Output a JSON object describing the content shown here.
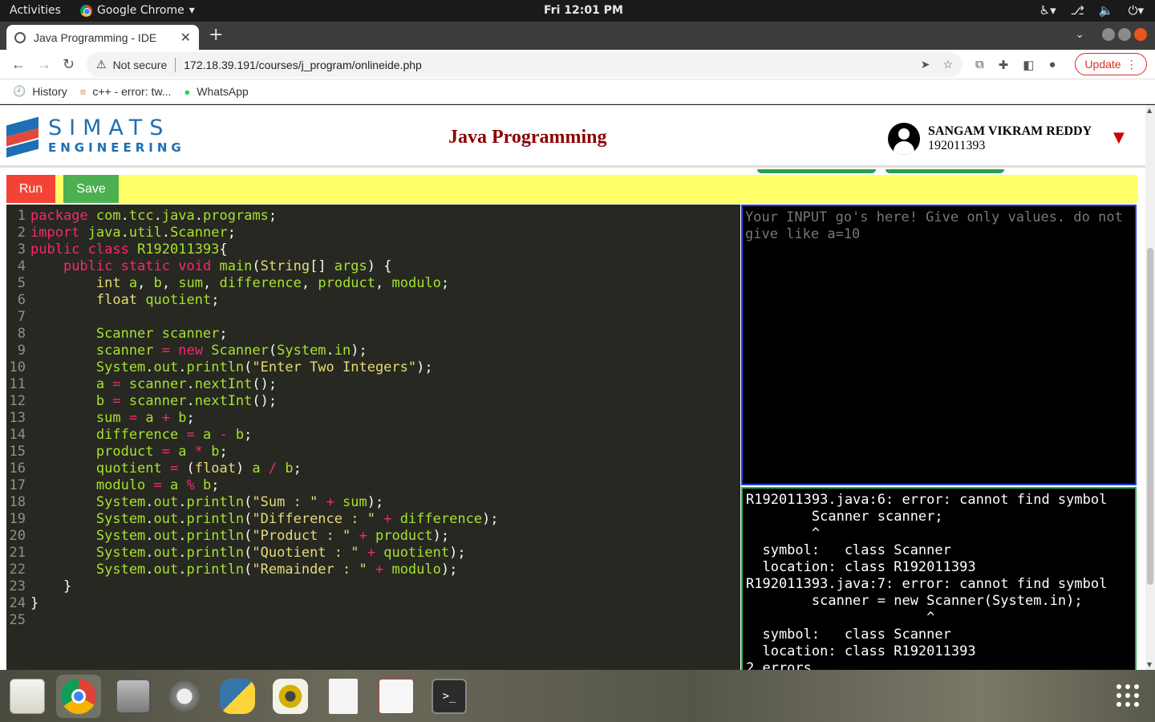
{
  "system": {
    "activities": "Activities",
    "app_name": "Google Chrome",
    "clock": "Fri 12:01 PM"
  },
  "browser": {
    "tab_title": "Java Programming - IDE",
    "security": "Not secure",
    "url": "172.18.39.191/courses/j_program/onlineide.php",
    "update_label": "Update",
    "bookmarks": [
      "History",
      "c++ - error: tw...",
      "WhatsApp"
    ]
  },
  "header": {
    "logo_top": "SIMATS",
    "logo_bottom": "ENGINEERING",
    "title": "Java Programming",
    "user_name": "SANGAM VIKRAM REDDY",
    "user_id": "192011393"
  },
  "controls": {
    "run_label": "Run",
    "save_label": "Save"
  },
  "editor": {
    "line_numbers": [
      "1",
      "2",
      "3",
      "4",
      "5",
      "6",
      "7",
      "8",
      "9",
      "10",
      "11",
      "12",
      "13",
      "14",
      "15",
      "16",
      "17",
      "18",
      "19",
      "20",
      "21",
      "22",
      "23",
      "24",
      "25"
    ]
  },
  "input": {
    "placeholder": "Your INPUT go's here! Give only values. do not give like a=10"
  },
  "output": {
    "text": "R192011393.java:6: error: cannot find symbol\n        Scanner scanner;\n        ^\n  symbol:   class Scanner\n  location: class R192011393\nR192011393.java:7: error: cannot find symbol\n        scanner = new Scanner(System.in);\n                      ^\n  symbol:   class Scanner\n  location: class R192011393\n2 errors"
  },
  "colors": {
    "run": "#f44336",
    "save": "#4caf50",
    "runbar": "#ffff66",
    "title": "#8b0000",
    "input_border": "#1f3ef0",
    "output_border": "#22b04b"
  }
}
